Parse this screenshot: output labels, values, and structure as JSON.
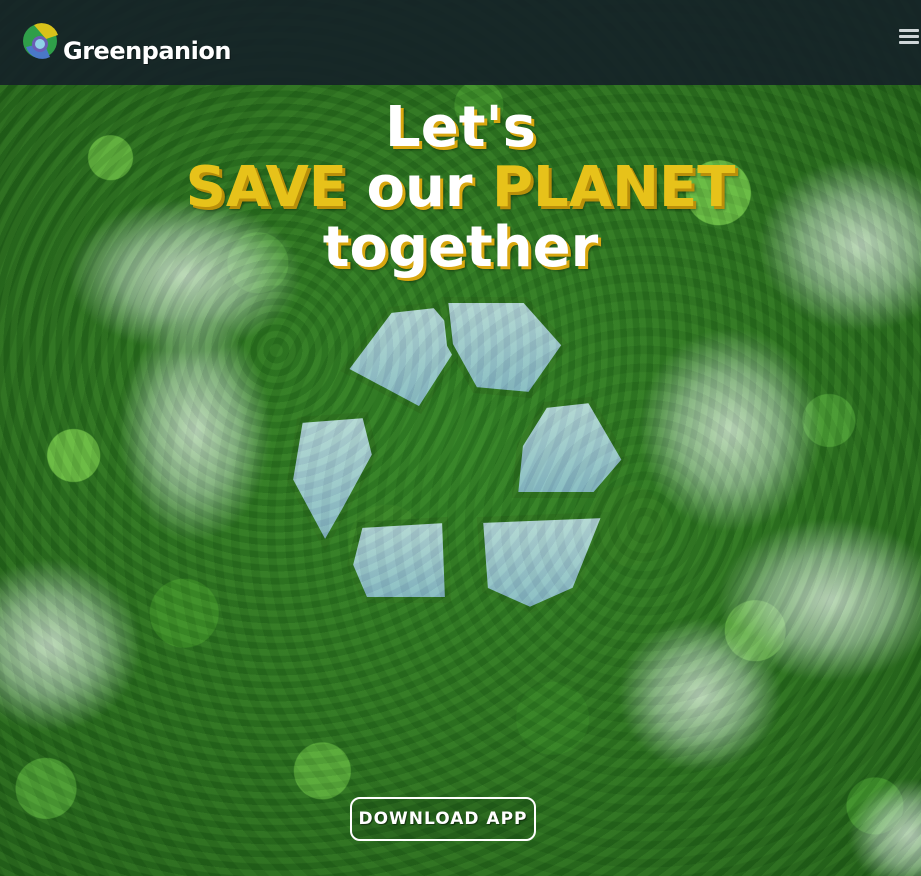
{
  "brand": {
    "name": "Greenpanion",
    "logo_icon": "greenpanion-logo-icon"
  },
  "nav": {
    "menu_icon": "hamburger-menu-icon"
  },
  "hero": {
    "line1": "Let's",
    "line2_highlight_1": "SAVE",
    "line2_middle": "our",
    "line2_highlight_2": "PLANET",
    "line3": "together",
    "background": "aerial-forest-recycle-lakes-image",
    "cta_label": "DOWNLOAD APP"
  },
  "colors": {
    "topbar": "#162228",
    "headline_white": "#ffffff",
    "headline_yellow": "#e7c21a",
    "shadow_gold": "#d9a70f",
    "lake_blue": "#a9cfe6"
  }
}
